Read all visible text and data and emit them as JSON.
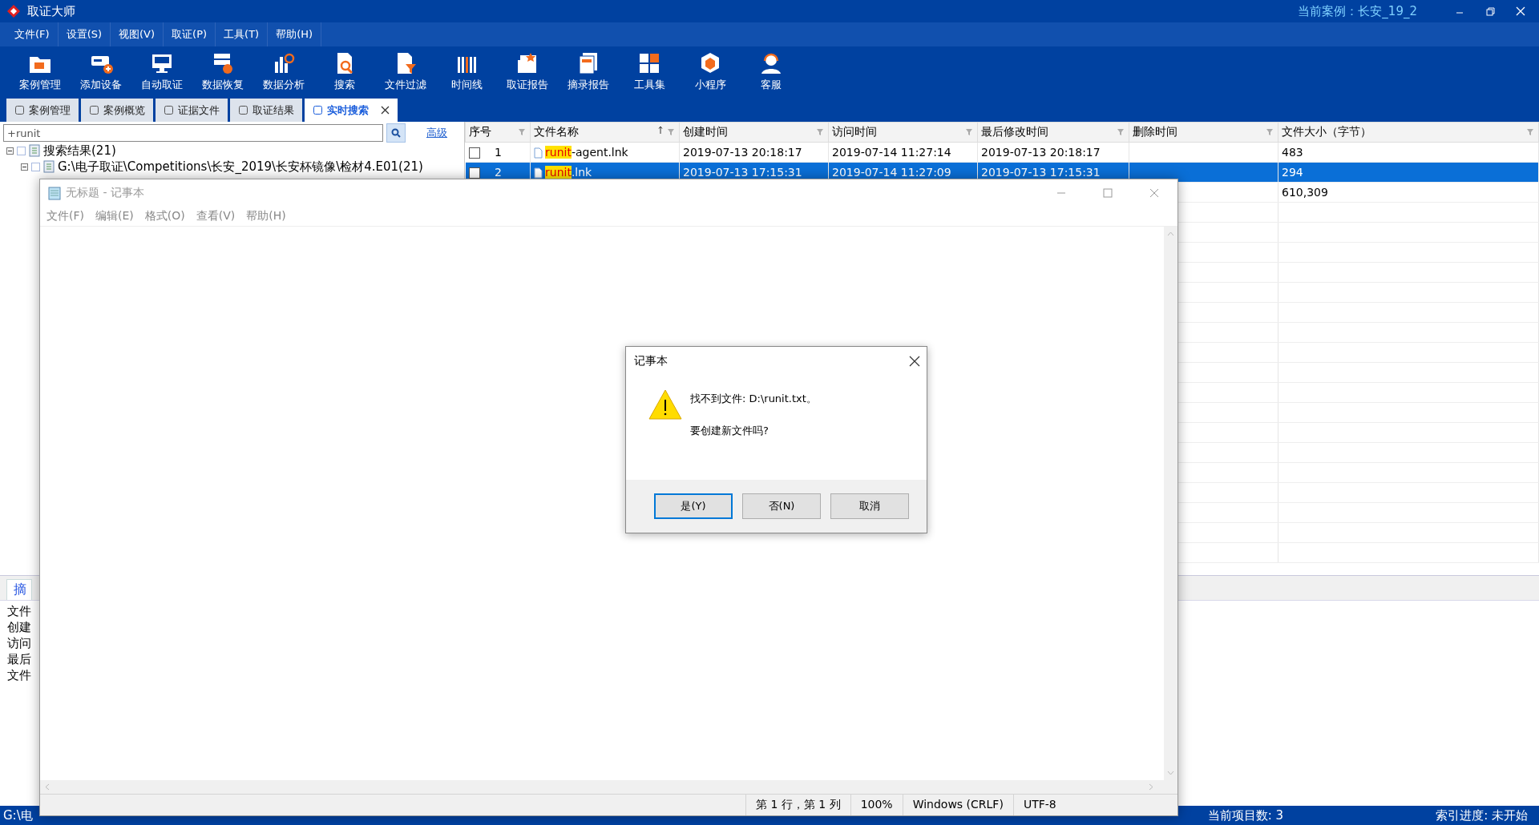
{
  "window": {
    "title": "取证大师",
    "current_case": "当前案例：长安_19_2"
  },
  "menu": [
    "文件(F)",
    "设置(S)",
    "视图(V)",
    "取证(P)",
    "工具(T)",
    "帮助(H)"
  ],
  "toolbar": [
    "案例管理",
    "添加设备",
    "自动取证",
    "数据恢复",
    "数据分析",
    "搜索",
    "文件过滤",
    "时间线",
    "取证报告",
    "摘录报告",
    "工具集",
    "小程序",
    "客服"
  ],
  "tabs": [
    {
      "label": "案例管理",
      "selected": false
    },
    {
      "label": "案例概览",
      "selected": false
    },
    {
      "label": "证据文件",
      "selected": false
    },
    {
      "label": "取证结果",
      "selected": false
    },
    {
      "label": "实时搜索",
      "selected": true,
      "closable": true
    }
  ],
  "search": {
    "value": "+runit",
    "advanced": "高级"
  },
  "tree": [
    {
      "label": "搜索结果(21)",
      "checked": false,
      "expanded": true,
      "children": [
        {
          "label": "G:\\电子取证\\Competitions\\长安_2019\\长安杯镜像\\检材4.E01(21)",
          "checked": false,
          "expanded": true
        }
      ]
    }
  ],
  "table": {
    "columns": [
      "序号",
      "文件名称",
      "创建时间",
      "访问时间",
      "最后修改时间",
      "删除时间",
      "文件大小（字节）"
    ],
    "rows": [
      {
        "selected": false,
        "checked": false,
        "index": "1",
        "match": "runit",
        "name_rest": "-agent.lnk",
        "created": "2019-07-13 20:18:17",
        "accessed": "2019-07-14 11:27:14",
        "modified": "2019-07-13 20:18:17",
        "size": "483"
      },
      {
        "selected": true,
        "checked": false,
        "index": "2",
        "match": "runit",
        "name_rest": ".lnk",
        "created": "2019-07-13 17:15:31",
        "accessed": "2019-07-14 11:27:09",
        "modified": "2019-07-13 17:15:31",
        "size": "294"
      },
      {
        "selected": false,
        "size": "610,309"
      }
    ]
  },
  "detail": {
    "tab": "摘",
    "fields": [
      "文件",
      "创建",
      "访问",
      "最后",
      "文件"
    ]
  },
  "status_bar": {
    "path": "G:\\电",
    "count": "当前项目数: 3",
    "index": "索引进度: 未开始"
  },
  "notepad": {
    "title": "无标题 - 记事本",
    "menu": [
      "文件(F)",
      "编辑(E)",
      "格式(O)",
      "查看(V)",
      "帮助(H)"
    ],
    "status": [
      "第 1 行，第 1 列",
      "100%",
      "Windows (CRLF)",
      "UTF-8"
    ]
  },
  "dialog": {
    "title": "记事本",
    "message": "找不到文件: D:\\runit.txt。",
    "question": "要创建新文件吗?",
    "buttons": [
      {
        "label": "是(Y)",
        "default": true
      },
      {
        "label": "否(N)",
        "default": false
      },
      {
        "label": "取消",
        "default": false
      }
    ]
  }
}
